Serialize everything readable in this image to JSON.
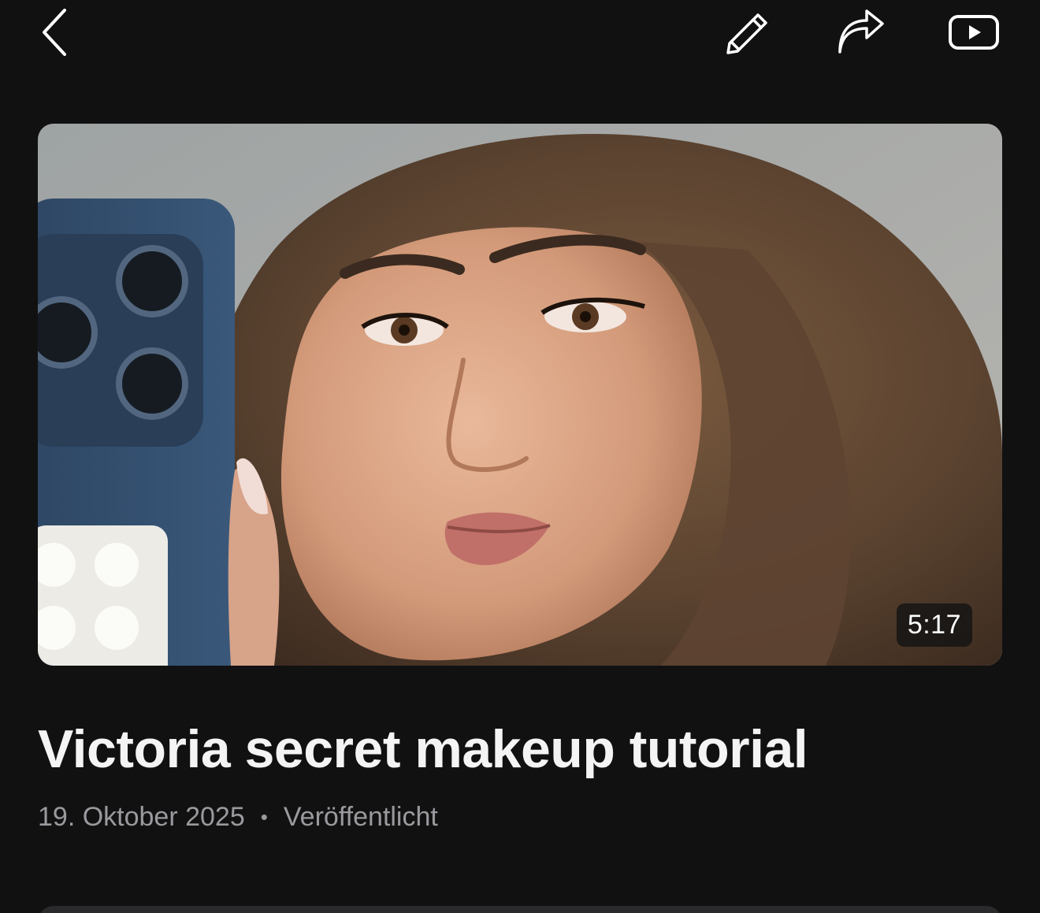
{
  "toolbar": {
    "back_icon": "chevron-left-icon",
    "edit_icon": "pencil-icon",
    "share_icon": "share-arrow-icon",
    "youtube_icon": "youtube-play-icon"
  },
  "video": {
    "thumbnail_icon": "video-thumbnail",
    "duration": "5:17",
    "title": "Victoria secret makeup tutorial",
    "date": "19. Oktober 2025",
    "separator": "•",
    "status": "Veröffentlicht"
  },
  "colors": {
    "background": "#111112",
    "text_primary": "#f4f4f4",
    "text_secondary": "#9a9a9e"
  }
}
